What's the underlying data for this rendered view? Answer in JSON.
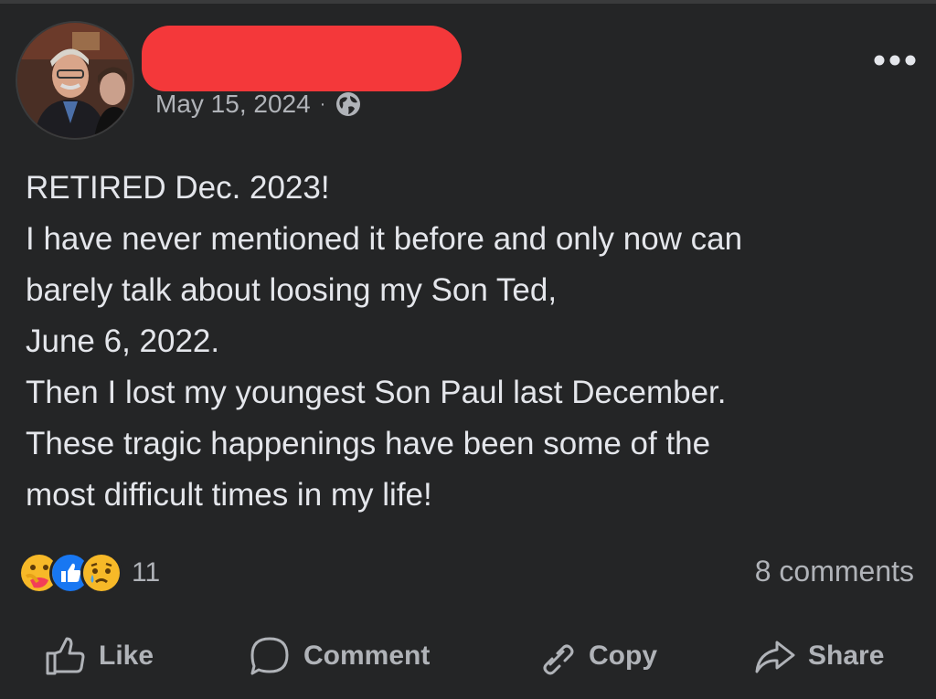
{
  "post": {
    "author_name": "",
    "date": "May 15, 2024",
    "separator": "·",
    "audience_icon": "globe-icon",
    "more_icon": "more-options-icon",
    "lines": [
      "RETIRED Dec. 2023!",
      "I have never mentioned it before and only now can",
      "barely talk about loosing my Son Ted,",
      "June 6, 2022.",
      "Then I lost my youngest Son Paul last December.",
      "These tragic happenings have been some of the",
      "most difficult times in my life!"
    ]
  },
  "reactions": {
    "icons": [
      "care-reaction-icon",
      "like-reaction-icon",
      "sad-reaction-icon"
    ],
    "count": "11",
    "comments": "8 comments"
  },
  "actions": {
    "like": "Like",
    "comment": "Comment",
    "copy": "Copy",
    "share": "Share"
  },
  "colors": {
    "background": "#242526",
    "text": "#e4e6eb",
    "secondary_text": "#b0b3b8",
    "redaction": "#f4383a",
    "like_blue": "#1877f2",
    "reaction_yellow": "#f7b928"
  }
}
